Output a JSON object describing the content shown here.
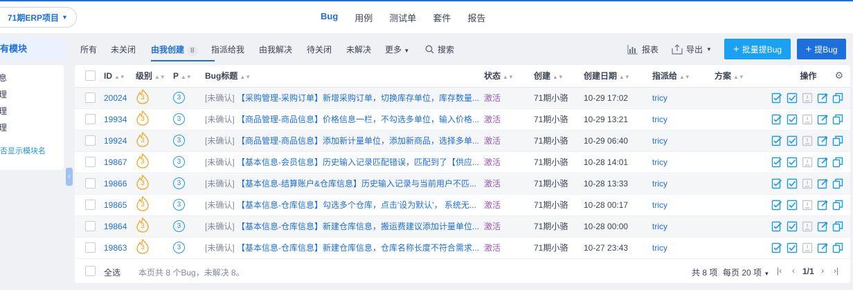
{
  "project": {
    "name": "71期ERP项目"
  },
  "nav": [
    "Bug",
    "用例",
    "测试单",
    "套件",
    "报告"
  ],
  "sidebar": {
    "title": "有模块",
    "modules": [
      "息",
      "理",
      "理",
      "理"
    ],
    "option": "否显示模块名"
  },
  "tabs": [
    {
      "label": "所有"
    },
    {
      "label": "未关闭"
    },
    {
      "label": "由我创建",
      "count": "8"
    },
    {
      "label": "指派给我"
    },
    {
      "label": "由我解决"
    },
    {
      "label": "待关闭"
    },
    {
      "label": "未解决"
    },
    {
      "label": "更多"
    }
  ],
  "toolbar": {
    "search": "搜索",
    "report": "报表",
    "export": "导出",
    "batch_create": "批量提Bug",
    "create": "提Bug"
  },
  "columns": {
    "id": "ID",
    "severity": "级别",
    "pri": "P",
    "title": "Bug标题",
    "status": "状态",
    "creator": "创建",
    "date": "创建日期",
    "assigned": "指派给",
    "resolution": "方案",
    "actions": "操作"
  },
  "rows": [
    {
      "id": "20024",
      "severity": "3",
      "pri": "3",
      "tag": "[未确认]",
      "title": "【采购管理-采购订单】新增采购订单，切换库存单位，库存数量...",
      "status": "激活",
      "creator": "71期小骆",
      "date": "10-29 17:02",
      "assigned": "tricy"
    },
    {
      "id": "19934",
      "severity": "3",
      "pri": "3",
      "tag": "[未确认]",
      "title": "【商品管理-商品信息】价格信息一栏，不勾选多单位，输入价格...",
      "status": "激活",
      "creator": "71期小骆",
      "date": "10-29 13:21",
      "assigned": "tricy"
    },
    {
      "id": "19924",
      "severity": "3",
      "pri": "3",
      "tag": "[未确认]",
      "title": "【商品管理-商品信息】添加新计量单位，添加新商品，选择多单...",
      "status": "激活",
      "creator": "71期小骆",
      "date": "10-29 06:40",
      "assigned": "tricy"
    },
    {
      "id": "19867",
      "severity": "3",
      "pri": "3",
      "tag": "[未确认]",
      "title": "【基本信息-会员信息】历史输入记录匹配错误，匹配到了【供应...",
      "status": "激活",
      "creator": "71期小骆",
      "date": "10-28 14:01",
      "assigned": "tricy"
    },
    {
      "id": "19866",
      "severity": "3",
      "pri": "3",
      "tag": "[未确认]",
      "title": "【基本信息-结算账户&仓库信息】历史输入记录与当前用户不匹...",
      "status": "激活",
      "creator": "71期小骆",
      "date": "10-28 13:33",
      "assigned": "tricy"
    },
    {
      "id": "19865",
      "severity": "3",
      "pri": "3",
      "tag": "[未确认]",
      "title": "【基本信息-仓库信息】勾选多个仓库，点击'设为默认'， 系统无...",
      "status": "激活",
      "creator": "71期小骆",
      "date": "10-28 00:17",
      "assigned": "tricy"
    },
    {
      "id": "19864",
      "severity": "3",
      "pri": "3",
      "tag": "[未确认]",
      "title": "【基本信息-仓库信息】新建仓库信息，搬运费建议添加计量单位...",
      "status": "激活",
      "creator": "71期小骆",
      "date": "10-28 00:00",
      "assigned": "tricy"
    },
    {
      "id": "19863",
      "severity": "3",
      "pri": "3",
      "tag": "[未确认]",
      "title": "【基本信息-仓库信息】新建仓库信息，仓库名称长度不符合需求...",
      "status": "激活",
      "creator": "71期小骆",
      "date": "10-27 23:43",
      "assigned": "tricy"
    }
  ],
  "footer": {
    "select_all": "全选",
    "summary": "本页共 8 个Bug，未解决 8。",
    "total": "共 8 项",
    "per_page": "每页 20 项",
    "page": "1/1"
  },
  "colors": {
    "primary": "#1e6fde",
    "accent": "#1ba1f2",
    "status": "#9b59b6",
    "severity": "#f5a623"
  }
}
